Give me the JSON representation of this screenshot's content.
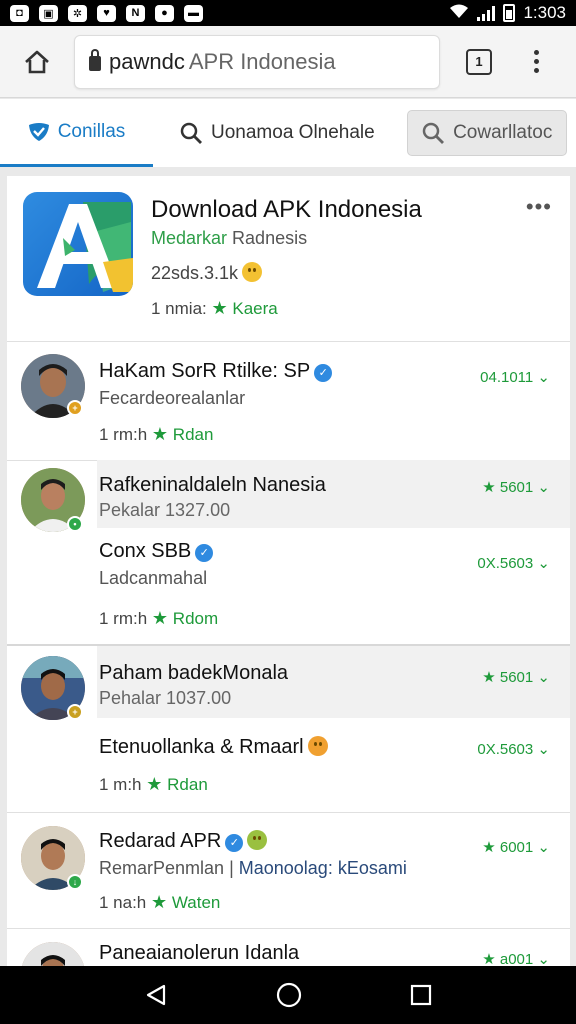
{
  "status_bar": {
    "time": "1:303"
  },
  "browser": {
    "url_domain": "pawndc",
    "url_rest": "APR Indonesia",
    "tab_count": "1"
  },
  "tabs": [
    {
      "label": "Conillas"
    },
    {
      "label": "Uonamoa Olnehale"
    },
    {
      "label": "Cowarllatoc"
    }
  ],
  "app": {
    "title": "Download APK Indonesia",
    "subtitle_green": "Medarkar",
    "subtitle_gray": "Radnesis",
    "meta": "22sds.3.1k",
    "rating_prefix": "1 nmia:",
    "rating_label": "Kaera"
  },
  "items": [
    {
      "name": "HaKam SorR Rtilke: SP",
      "sub": "Fecardeorealanlar",
      "time": "1 rm:h",
      "rating": "Rdan",
      "right": "04.1011"
    },
    {
      "name": "Rafkeninaldaleln Nanesia",
      "sub": "Pekalar 1327.00",
      "time": "",
      "rating": "",
      "right": "5601"
    },
    {
      "name": "Conx SBB",
      "sub": "Ladcanmahal",
      "time": "1 rm:h",
      "rating": "Rdom",
      "right": "0X.5603"
    },
    {
      "name": "Paham badekMonala",
      "sub": "Pehalar 1037.00",
      "time": "",
      "rating": "",
      "right": "5601"
    },
    {
      "name": "Etenuollanka & Rmaarl",
      "sub": "",
      "time": "1 m:h",
      "rating": "Rdan",
      "right": "0X.5603"
    },
    {
      "name": "Redarad APR",
      "sub_a": "RemarPenmlan",
      "sub_b": "Maonoolag: kEosami",
      "time": "1 na:h",
      "rating": "Waten",
      "right": "6001"
    },
    {
      "name": "Paneaianolerun Idanla",
      "right": "a001"
    }
  ],
  "colors": {
    "accent": "#1a7cc6",
    "green": "#1e9a3a"
  }
}
